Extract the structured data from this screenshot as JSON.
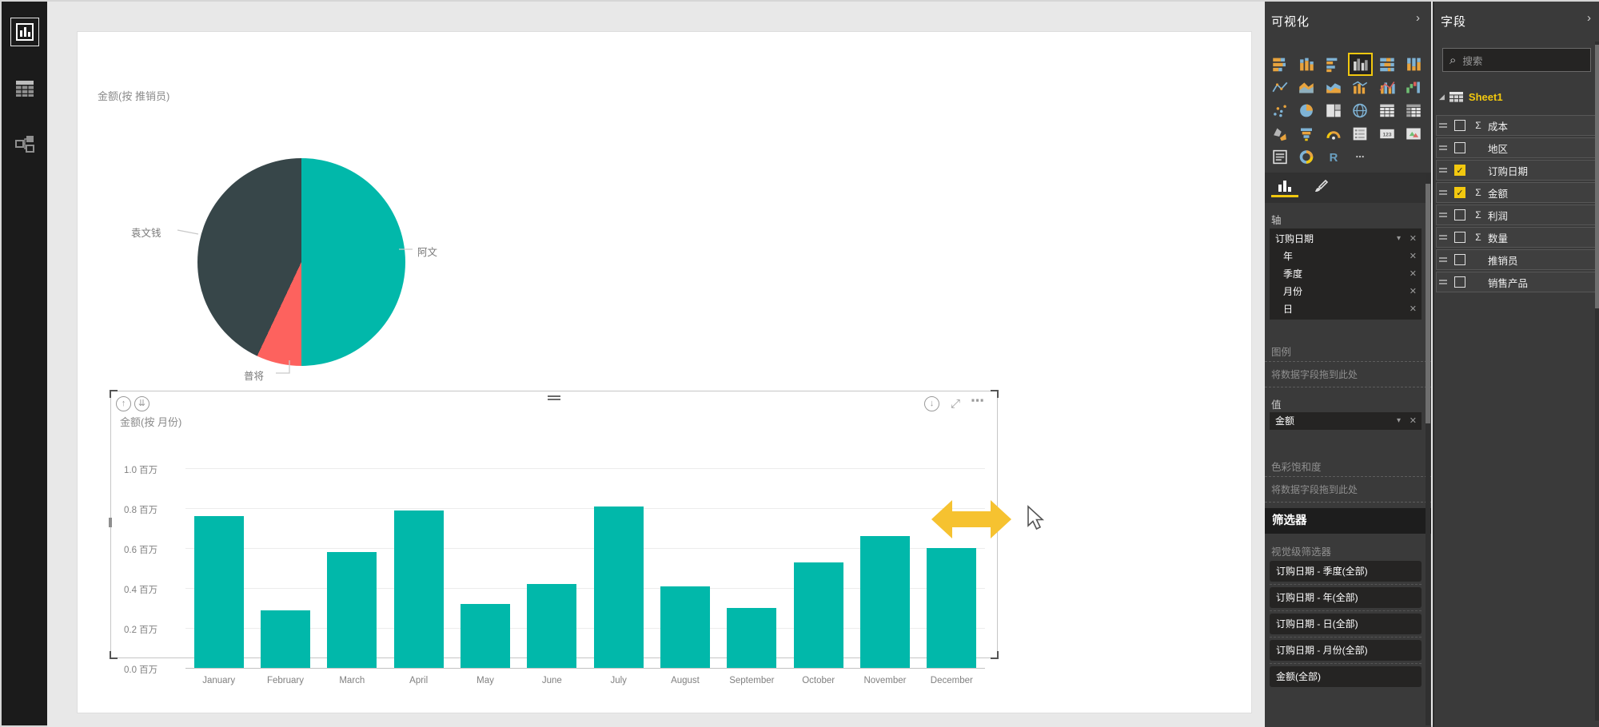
{
  "glyphs": {
    "chevron_right": "›",
    "caret_down": "▾",
    "close": "✕",
    "sigma": "Σ",
    "more": "⋯",
    "drill_up": "↑",
    "drill_down": "↓",
    "expand_all": "⇊",
    "focus_mode": "⤢",
    "search": "⌕",
    "check": "✓",
    "expander": "◢"
  },
  "colors": {
    "teal": "#01B8AA",
    "dark_slice": "#374649",
    "red_slice": "#FD625E",
    "accent_yellow": "#F2C80F",
    "resize_arrow": "#F6C230"
  },
  "left_nav": {
    "items": [
      {
        "name": "report-view",
        "selected": true
      },
      {
        "name": "data-view",
        "selected": false
      },
      {
        "name": "model-view",
        "selected": false
      }
    ]
  },
  "chart_data": [
    {
      "type": "pie",
      "title": "金额(按 推销员)",
      "labels": [
        "阿文",
        "普将",
        "袁文钱"
      ],
      "values_pct": [
        50,
        7,
        43
      ],
      "colors": [
        "#01B8AA",
        "#FD625E",
        "#374649"
      ],
      "legend_position": "data-labels-outside"
    },
    {
      "type": "bar",
      "title": "金额(按 月份)",
      "categories": [
        "January",
        "February",
        "March",
        "April",
        "May",
        "June",
        "July",
        "August",
        "September",
        "October",
        "November",
        "December"
      ],
      "values": [
        0.76,
        0.29,
        0.58,
        0.79,
        0.32,
        0.42,
        0.81,
        0.41,
        0.3,
        0.53,
        0.66,
        0.6
      ],
      "unit": "百万",
      "yticks": [
        "1.0 百万",
        "0.8 百万",
        "0.6 百万",
        "0.4 百万",
        "0.2 百万",
        "0.0 百万"
      ],
      "ylim": [
        0,
        1.0
      ],
      "grid": true,
      "bar_color": "#01B8AA"
    }
  ],
  "panels": {
    "visualizations": {
      "title": "可视化",
      "icons": [
        "stacked-bar",
        "stacked-column",
        "clustered-bar",
        "clustered-column",
        "100-stacked-bar",
        "100-stacked-column",
        "line",
        "area",
        "stacked-area",
        "line-stacked-column",
        "line-clustered-column",
        "waterfall",
        "scatter",
        "pie",
        "treemap",
        "map",
        "table",
        "matrix",
        "filled-map",
        "funnel",
        "gauge",
        "multi-row-card",
        "card",
        "kpi",
        "slicer",
        "donut",
        "r-script",
        "more"
      ],
      "selected_icon_index": 3,
      "tabs": [
        "fields",
        "format"
      ],
      "axis": {
        "label": "轴",
        "fields": [
          {
            "label": "订购日期",
            "has_caret": true,
            "indent": false
          },
          {
            "label": "年",
            "has_caret": false,
            "indent": true
          },
          {
            "label": "季度",
            "has_caret": false,
            "indent": true
          },
          {
            "label": "月份",
            "has_caret": false,
            "indent": true
          },
          {
            "label": "日",
            "has_caret": false,
            "indent": true
          }
        ]
      },
      "legend": {
        "label": "图例"
      },
      "drop_hint": "将数据字段拖到此处",
      "values": {
        "label": "值",
        "fields": [
          {
            "label": "金额",
            "has_caret": true
          }
        ]
      },
      "saturation": {
        "label": "色彩饱和度"
      },
      "filters": {
        "header": "筛选器",
        "visual_level_label": "视觉级筛选器",
        "items": [
          "订购日期 - 季度(全部)",
          "订购日期 - 年(全部)",
          "订购日期 - 日(全部)",
          "订购日期 - 月份(全部)",
          "金额(全部)"
        ]
      }
    },
    "fields": {
      "title": "字段",
      "search_placeholder": "搜索",
      "table": "Sheet1",
      "items": [
        {
          "label": "成本",
          "sigma": true,
          "checked": false
        },
        {
          "label": "地区",
          "sigma": false,
          "checked": false
        },
        {
          "label": "订购日期",
          "sigma": false,
          "checked": true
        },
        {
          "label": "金额",
          "sigma": true,
          "checked": true
        },
        {
          "label": "利润",
          "sigma": true,
          "checked": false
        },
        {
          "label": "数量",
          "sigma": true,
          "checked": false
        },
        {
          "label": "推销员",
          "sigma": false,
          "checked": false
        },
        {
          "label": "销售产品",
          "sigma": false,
          "checked": false
        }
      ]
    }
  }
}
